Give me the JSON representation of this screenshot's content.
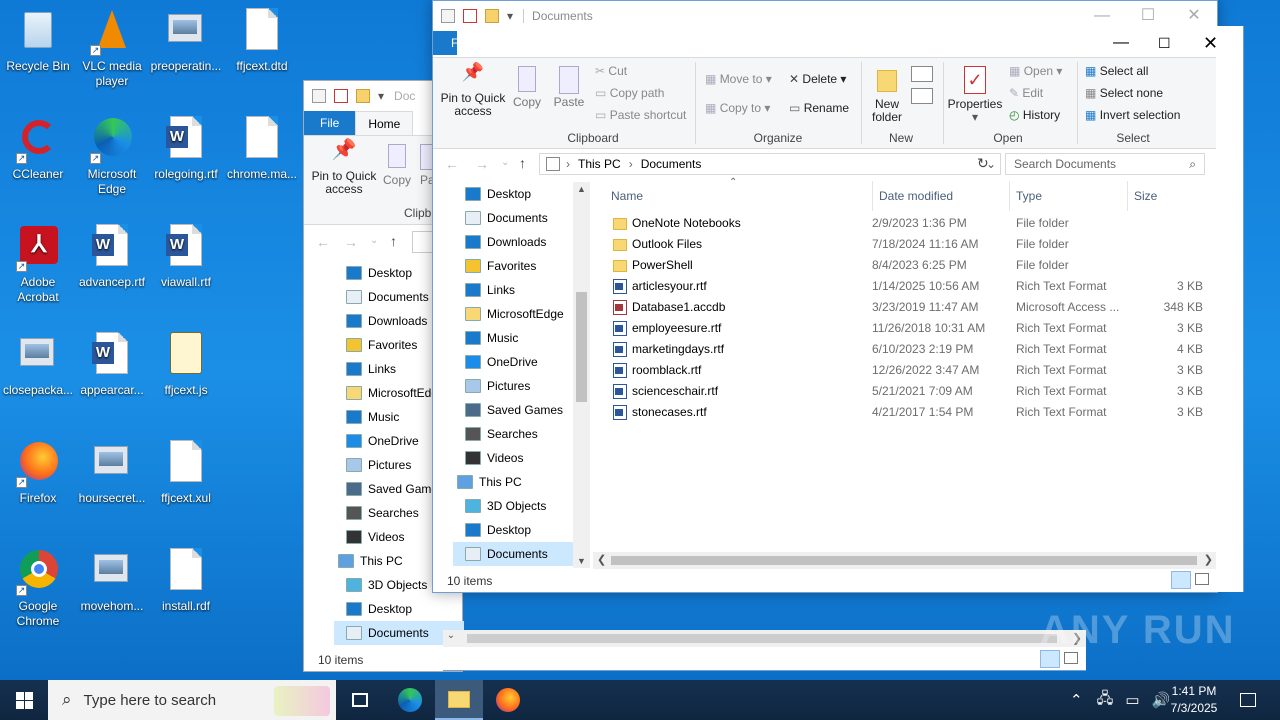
{
  "desktop_icons": [
    {
      "label": "Recycle Bin",
      "icon": "recycle-bin-icon"
    },
    {
      "label": "VLC media player",
      "icon": "vlc-icon"
    },
    {
      "label": "preoperatin...",
      "icon": "image-file-icon"
    },
    {
      "label": "ffjcext.dtd",
      "icon": "file-icon"
    },
    {
      "label": "CCleaner",
      "icon": "ccleaner-icon"
    },
    {
      "label": "Microsoft Edge",
      "icon": "edge-icon"
    },
    {
      "label": "rolegoing.rtf",
      "icon": "word-icon"
    },
    {
      "label": "chrome.ma...",
      "icon": "file-icon"
    },
    {
      "label": "Adobe Acrobat",
      "icon": "acrobat-icon"
    },
    {
      "label": "advancep.rtf",
      "icon": "word-icon"
    },
    {
      "label": "viawall.rtf",
      "icon": "word-icon"
    },
    {
      "label": "closepacka...",
      "icon": "image-file-icon"
    },
    {
      "label": "appearcar...",
      "icon": "word-icon"
    },
    {
      "label": "ffjcext.js",
      "icon": "script-icon"
    },
    {
      "label": "Firefox",
      "icon": "firefox-icon"
    },
    {
      "label": "hoursecret...",
      "icon": "image-file-icon"
    },
    {
      "label": "ffjcext.xul",
      "icon": "file-icon"
    },
    {
      "label": "Google Chrome",
      "icon": "chrome-icon"
    },
    {
      "label": "movehom...",
      "icon": "image-file-icon"
    },
    {
      "label": "install.rdf",
      "icon": "file-icon"
    }
  ],
  "back_window": {
    "title": "Doc",
    "tab_file": "File",
    "tab_home": "Home",
    "pin_label": "Pin to Quick access",
    "copy_label": "Copy",
    "paste_label": "Pa",
    "group_clipboard": "Clipb",
    "nav": [
      "Desktop",
      "Documents",
      "Downloads",
      "Favorites",
      "Links",
      "MicrosoftEdg",
      "Music",
      "OneDrive",
      "Pictures",
      "Saved Games",
      "Searches",
      "Videos",
      "This PC",
      "3D Objects",
      "Desktop",
      "Documents"
    ],
    "status": "10 items"
  },
  "front_window": {
    "title": "Documents",
    "tab_file": "F",
    "ribbon": {
      "pin": "Pin to Quick access",
      "copy": "Copy",
      "paste": "Paste",
      "cut": "Cut",
      "copy_path": "Copy path",
      "paste_shortcut": "Paste shortcut",
      "move_to": "Move to",
      "copy_to": "Copy to",
      "delete": "Delete",
      "rename": "Rename",
      "new_folder": "New folder",
      "properties": "Properties",
      "open": "Open",
      "edit": "Edit",
      "history": "History",
      "select_all": "Select all",
      "select_none": "Select none",
      "invert_selection": "Invert selection",
      "groups": {
        "clipboard": "Clipboard",
        "organize": "Organize",
        "new": "New",
        "open": "Open",
        "select": "Select"
      }
    },
    "address": {
      "crumbs": [
        "This PC",
        "Documents"
      ],
      "search_placeholder": "Search Documents"
    },
    "nav": [
      "Desktop",
      "Documents",
      "Downloads",
      "Favorites",
      "Links",
      "MicrosoftEdge",
      "Music",
      "OneDrive",
      "Pictures",
      "Saved Games",
      "Searches",
      "Videos",
      "This PC",
      "3D Objects",
      "Desktop",
      "Documents"
    ],
    "columns": [
      "Name",
      "Date modified",
      "Type",
      "Size"
    ],
    "files": [
      {
        "name": "OneNote Notebooks",
        "date": "2/9/2023 1:36 PM",
        "type": "File folder",
        "size": "",
        "kind": "folder"
      },
      {
        "name": "Outlook Files",
        "date": "7/18/2024 11:16 AM",
        "type": "File folder",
        "size": "",
        "kind": "folder"
      },
      {
        "name": "PowerShell",
        "date": "8/4/2023 6:25 PM",
        "type": "File folder",
        "size": "",
        "kind": "folder"
      },
      {
        "name": "articlesyour.rtf",
        "date": "1/14/2025 10:56 AM",
        "type": "Rich Text Format",
        "size": "3 KB",
        "kind": "rtf"
      },
      {
        "name": "Database1.accdb",
        "date": "3/23/2019 11:47 AM",
        "type": "Microsoft Access ...",
        "size": "348 KB",
        "kind": "accdb"
      },
      {
        "name": "employeesure.rtf",
        "date": "11/26/2018 10:31 AM",
        "type": "Rich Text Format",
        "size": "3 KB",
        "kind": "rtf"
      },
      {
        "name": "marketingdays.rtf",
        "date": "6/10/2023 2:19 PM",
        "type": "Rich Text Format",
        "size": "4 KB",
        "kind": "rtf"
      },
      {
        "name": "roomblack.rtf",
        "date": "12/26/2022 3:47 AM",
        "type": "Rich Text Format",
        "size": "3 KB",
        "kind": "rtf"
      },
      {
        "name": "scienceschair.rtf",
        "date": "5/21/2021 7:09 AM",
        "type": "Rich Text Format",
        "size": "3 KB",
        "kind": "rtf"
      },
      {
        "name": "stonecases.rtf",
        "date": "4/21/2017 1:54 PM",
        "type": "Rich Text Format",
        "size": "3 KB",
        "kind": "rtf"
      }
    ],
    "status": "10 items"
  },
  "taskbar": {
    "search_placeholder": "Type here to search",
    "time": "1:41 PM",
    "date": "7/3/2025"
  },
  "watermark": "ANY RUN"
}
